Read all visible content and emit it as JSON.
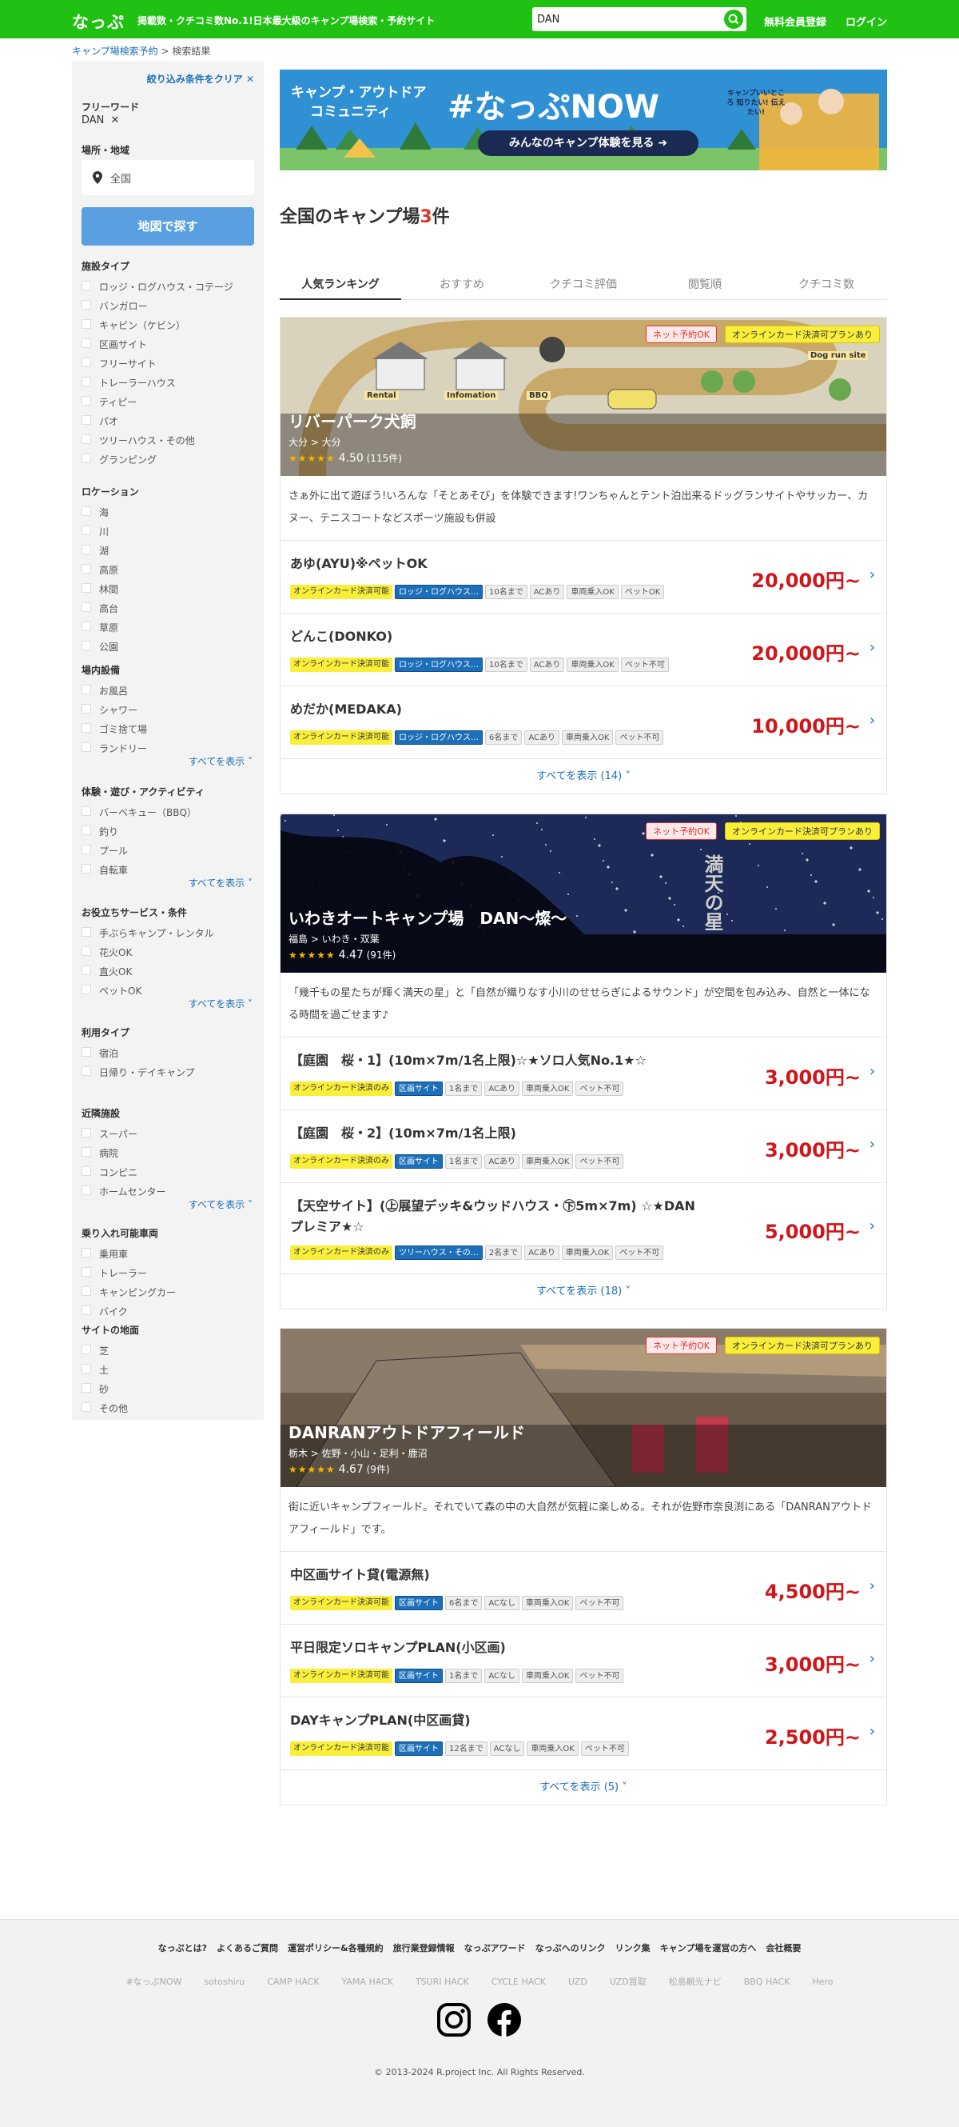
{
  "header": {
    "logo": "なっぷ",
    "tagline": "掲載数・クチコミ数No.1!日本最大級のキャンプ場検索・予約サイト",
    "search_value": "DAN",
    "register": "無料会員登録",
    "login": "ログイン"
  },
  "breadcrumb": {
    "home": "キャンプ場検索予約",
    "sep": " > ",
    "current": "検索結果"
  },
  "sidebar": {
    "clear": "絞り込み条件をクリア",
    "freeword_title": "フリーワード",
    "freeword_value": "DAN",
    "area_title": "場所・地域",
    "area_value": "全国",
    "map_button": "地図で探す",
    "more_label": "すべてを表示",
    "groups": [
      {
        "title": "施設タイプ",
        "items": [
          "ロッジ・ログハウス・コテージ",
          "バンガロー",
          "キャビン（ケビン）",
          "区画サイト",
          "フリーサイト",
          "トレーラーハウス",
          "ティピー",
          "パオ",
          "ツリーハウス・その他",
          "グランピング"
        ]
      },
      {
        "title": "ロケーション",
        "items": [
          "海",
          "川",
          "湖",
          "高原",
          "林間",
          "高台",
          "草原",
          "公園"
        ]
      },
      {
        "title": "場内設備",
        "items": [
          "お風呂",
          "シャワー",
          "ゴミ捨て場",
          "ランドリー"
        ],
        "more": true
      },
      {
        "title": "体験・遊び・アクティビティ",
        "items": [
          "バーベキュー（BBQ）",
          "釣り",
          "プール",
          "自転車"
        ],
        "more": true
      },
      {
        "title": "お役立ちサービス・条件",
        "items": [
          "手ぶらキャンプ・レンタル",
          "花火OK",
          "直火OK",
          "ペットOK"
        ],
        "more": true
      },
      {
        "title": "利用タイプ",
        "items": [
          "宿泊",
          "日帰り・デイキャンプ"
        ]
      },
      {
        "title": "近隣施設",
        "items": [
          "スーパー",
          "病院",
          "コンビニ",
          "ホームセンター"
        ],
        "more": true
      },
      {
        "title": "乗り入れ可能車両",
        "items": [
          "乗用車",
          "トレーラー",
          "キャンピングカー",
          "バイク"
        ]
      },
      {
        "title": "サイトの地面",
        "items": [
          "芝",
          "土",
          "砂",
          "その他"
        ]
      }
    ]
  },
  "banner": {
    "line1": "キャンプ・アウトドア",
    "line2": "コミュニティ",
    "brand": "#なっぷNOW",
    "cta": "みんなのキャンプ体験を見る",
    "note": "キャンプいいところ 知りたい! 伝えたい!"
  },
  "results": {
    "prefix": "全国のキャンプ場",
    "count": "3",
    "suffix": "件"
  },
  "tabs": [
    "人気ランキング",
    "おすすめ",
    "クチコミ評価",
    "閲覧順",
    "クチコミ数"
  ],
  "badges": {
    "net": "ネット予約OK",
    "card": "オンラインカード決済可プランあり"
  },
  "cards": [
    {
      "name": "リバーパーク犬飼",
      "loc": "大分 > 大分",
      "stars": "★★★★★",
      "rating": "4.50",
      "reviews": "(115件)",
      "desc": "さぁ外に出て遊ぼう!いろんな「そとあそび」を体験できます!ワンちゃんとテント泊出来るドッグランサイトやサッカー、カヌー、テニスコートなどスポーツ施設も併設",
      "sign_labels": [
        "Rental",
        "Infomation",
        "BBQ",
        "Dog run site"
      ],
      "plans": [
        {
          "name": "あゆ(AYU)※ペットOK",
          "tags": [
            "オンラインカード決済可能",
            "ロッジ・ログハウス…",
            "10名まで",
            "ACあり",
            "車両乗入OK",
            "ペットOK"
          ],
          "price": "20,000円~"
        },
        {
          "name": "どんこ(DONKO)",
          "tags": [
            "オンラインカード決済可能",
            "ロッジ・ログハウス…",
            "10名まで",
            "ACあり",
            "車両乗入OK",
            "ペット不可"
          ],
          "price": "20,000円~"
        },
        {
          "name": "めだか(MEDAKA)",
          "tags": [
            "オンラインカード決済可能",
            "ロッジ・ログハウス…",
            "6名まで",
            "ACあり",
            "車両乗入OK",
            "ペット不可"
          ],
          "price": "10,000円~"
        }
      ],
      "showall": "すべてを表示 (14)"
    },
    {
      "name": "いわきオートキャンプ場　DAN〜燦〜",
      "loc": "福島 > いわき・双葉",
      "stars": "★★★★★",
      "rating": "4.47",
      "reviews": "(91件)",
      "desc": "「幾千もの星たちが輝く満天の星」と「自然が織りなす小川のせせらぎによるサウンド」が空間を包み込み、自然と一体になる時間を過ごせます♪",
      "img_text": "満天の星",
      "plans": [
        {
          "name": "【庭園　桜・1】(10m×7m/1名上限)☆★ソロ人気No.1★☆",
          "tags": [
            "オンラインカード決済のみ",
            "区画サイト",
            "1名まで",
            "ACあり",
            "車両乗入OK",
            "ペット不可"
          ],
          "price": "3,000円~"
        },
        {
          "name": "【庭園　桜・2】(10m×7m/1名上限)",
          "tags": [
            "オンラインカード決済のみ",
            "区画サイト",
            "1名まで",
            "ACあり",
            "車両乗入OK",
            "ペット不可"
          ],
          "price": "3,000円~"
        },
        {
          "name": "【天空サイト】(㊤展望デッキ&ウッドハウス・㊦5m×7m) ☆★DANプレミア★☆",
          "tags": [
            "オンラインカード決済のみ",
            "ツリーハウス・その…",
            "2名まで",
            "ACあり",
            "車両乗入OK",
            "ペット不可"
          ],
          "price": "5,000円~"
        }
      ],
      "showall": "すべてを表示 (18)"
    },
    {
      "name": "DANRANアウトドアフィールド",
      "loc": "栃木 > 佐野・小山・足利・鹿沼",
      "stars": "★★★★★",
      "rating": "4.67",
      "reviews": "(9件)",
      "desc": "街に近いキャンプフィールド。それでいて森の中の大自然が気軽に楽しめる。それが佐野市奈良渕にある「DANRANアウトドアフィールド」です。",
      "plans": [
        {
          "name": "中区画サイト貸(電源無)",
          "tags": [
            "オンラインカード決済可能",
            "区画サイト",
            "6名まで",
            "ACなし",
            "車両乗入OK",
            "ペット不可"
          ],
          "price": "4,500円~"
        },
        {
          "name": "平日限定ソロキャンプPLAN(小区画)",
          "tags": [
            "オンラインカード決済可能",
            "区画サイト",
            "1名まで",
            "ACなし",
            "車両乗入OK",
            "ペット不可"
          ],
          "price": "3,000円~"
        },
        {
          "name": "DAYキャンプPLAN(中区画貸)",
          "tags": [
            "オンラインカード決済可能",
            "区画サイト",
            "12名まで",
            "ACなし",
            "車両乗入OK",
            "ペット不可"
          ],
          "price": "2,500円~"
        }
      ],
      "showall": "すべてを表示 (5)"
    }
  ],
  "footer": {
    "links": [
      "なっぷとは?",
      "よくあるご質問",
      "運営ポリシー&各種規約",
      "旅行業登録情報",
      "なっぷアワード",
      "なっぷへのリンク",
      "リンク集",
      "キャンプ場を運営の方へ",
      "会社概要"
    ],
    "sites": [
      "#なっぷNOW",
      "sotoshiru",
      "CAMP HACK",
      "YAMA HACK",
      "TSURI HACK",
      "CYCLE HACK",
      "UZD",
      "UZD買取",
      "松島観光ナビ",
      "BBQ HACK",
      "Hero"
    ],
    "copyright": "© 2013-2024 R.project Inc. All Rights Reserved."
  }
}
